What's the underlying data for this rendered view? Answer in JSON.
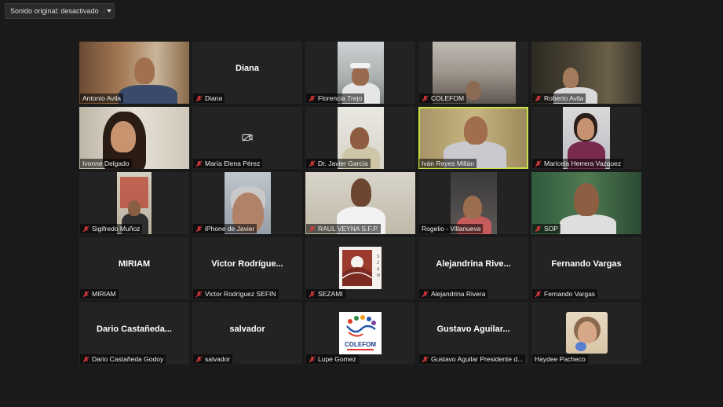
{
  "toolbar": {
    "audio_label": "Sonido original: desactivado"
  },
  "participants": [
    {
      "label": "Antonio Avila",
      "muted": false
    },
    {
      "label": "Diana",
      "big": "Diana",
      "muted": true
    },
    {
      "label": "Florencia Trejo",
      "muted": true
    },
    {
      "label": "COLEFOM",
      "muted": true
    },
    {
      "label": "Roberto Avila",
      "muted": true
    },
    {
      "label": "Ivonne Delgado",
      "muted": false
    },
    {
      "label": "María Elena Pérez",
      "muted": true,
      "camera_off": true
    },
    {
      "label": "Dr. Javier García",
      "muted": true
    },
    {
      "label": "Iván Reyes Millán",
      "muted": false,
      "active": true
    },
    {
      "label": "Maricela Herrera Vazquez",
      "muted": true
    },
    {
      "label": "Sigifredo Muñoz",
      "muted": true
    },
    {
      "label": "iPhone de Javier",
      "muted": true
    },
    {
      "label": "RAUL VEYNA S.F.P.",
      "muted": true
    },
    {
      "label": "Rogelio - Villanueva",
      "muted": false
    },
    {
      "label": "SOP",
      "muted": true
    },
    {
      "label": "MIRIAM",
      "big": "MIRIAM",
      "muted": true
    },
    {
      "label": "Victor Rodríguez SEFIN",
      "big": "Victor  Rodrígue...",
      "muted": true
    },
    {
      "label": "SEZAMI",
      "muted": true
    },
    {
      "label": "Alejandrina Rivera",
      "big": "Alejandrina  Rive...",
      "muted": true
    },
    {
      "label": "Fernando Vargas",
      "big": "Fernando Vargas",
      "muted": true
    },
    {
      "label": "Dario Castañeda Godoy",
      "big": "Dario  Castañeda...",
      "muted": true
    },
    {
      "label": "salvador",
      "big": "salvador",
      "muted": true
    },
    {
      "label": "Lupe Gomez",
      "muted": true
    },
    {
      "label": "Gustavo Aguilar Presidente d...",
      "big": "Gustavo  Aguilar...",
      "muted": true
    },
    {
      "label": "Haydee Pacheco",
      "muted": false
    }
  ],
  "logos": {
    "colefom": "COLEFOM",
    "sezami": "SEZAMI"
  },
  "icons": {
    "muted": "mic-muted-icon",
    "camera_off": "camera-off-icon",
    "dropdown": "chevron-down-icon"
  },
  "colors": {
    "active_border": "#c6e14b",
    "tile_bg": "#232323",
    "muted_icon": "#e0393e"
  }
}
